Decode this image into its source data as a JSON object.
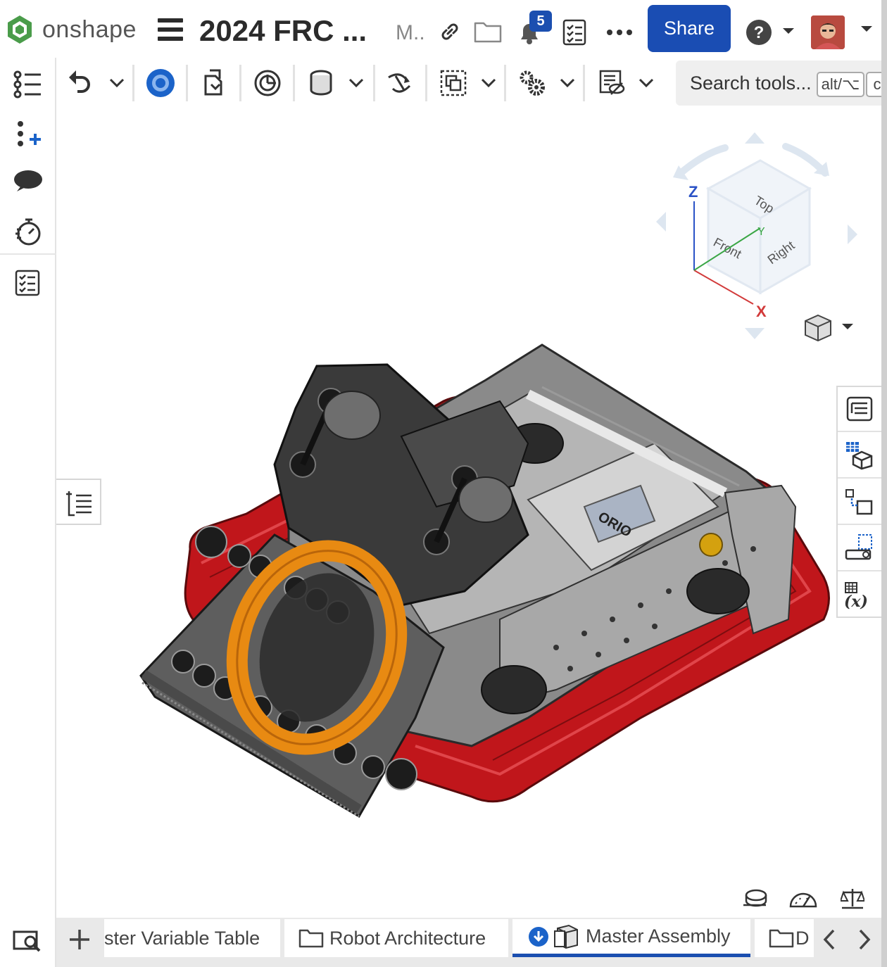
{
  "header": {
    "logo_text": "onshape",
    "doc_title": "2024 FRC ...",
    "workspace": "M..",
    "notification_count": "5",
    "share_label": "Share"
  },
  "toolbar": {
    "search_placeholder": "Search tools...",
    "shortcut_hint": "alt/⌥",
    "shortcut_hint_2": "c"
  },
  "viewcube": {
    "axis_z": "Z",
    "axis_y": "Y",
    "axis_x": "X",
    "face_top": "Top",
    "face_front": "Front",
    "face_right": "Right"
  },
  "model": {
    "logo_text": "ORIO"
  },
  "tabs": [
    {
      "label": "ster Variable Table"
    },
    {
      "label": "Robot Architecture"
    },
    {
      "label": "Master Assembly"
    },
    {
      "label": "D"
    }
  ],
  "colors": {
    "accent": "#1a4db3",
    "bumper": "#c0161b",
    "intake_ring": "#e88a12",
    "logo_green": "#4a9c4a"
  }
}
